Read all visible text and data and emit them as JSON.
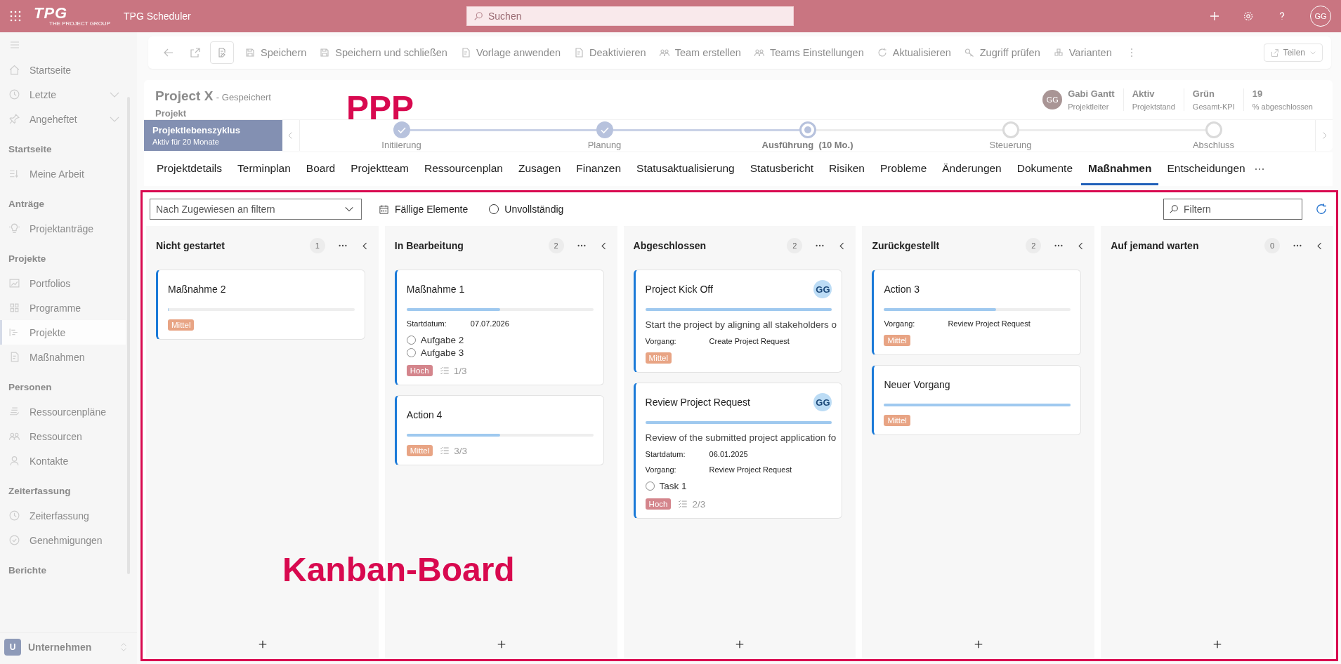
{
  "app_bar": {
    "logo": "TPG",
    "logo_subtitle": "THE PROJECT GROUP",
    "title": "TPG Scheduler",
    "search_placeholder": "Suchen",
    "avatar": "GG"
  },
  "sidebar": {
    "items": [
      {
        "kind": "item",
        "label": "Startseite",
        "selected": false
      },
      {
        "kind": "item",
        "label": "Letzte",
        "selected": false,
        "expandable": true
      },
      {
        "kind": "item",
        "label": "Angeheftet",
        "selected": false,
        "expandable": true
      },
      {
        "kind": "section",
        "label": "Startseite"
      },
      {
        "kind": "item",
        "label": "Meine Arbeit",
        "selected": false
      },
      {
        "kind": "section",
        "label": "Anträge"
      },
      {
        "kind": "item",
        "label": "Projektanträge",
        "selected": false
      },
      {
        "kind": "section",
        "label": "Projekte"
      },
      {
        "kind": "item",
        "label": "Portfolios",
        "selected": false
      },
      {
        "kind": "item",
        "label": "Programme",
        "selected": false
      },
      {
        "kind": "item",
        "label": "Projekte",
        "selected": true
      },
      {
        "kind": "item",
        "label": "Maßnahmen",
        "selected": false
      },
      {
        "kind": "section",
        "label": "Personen"
      },
      {
        "kind": "item",
        "label": "Ressourcenpläne",
        "selected": false
      },
      {
        "kind": "item",
        "label": "Ressourcen",
        "selected": false
      },
      {
        "kind": "item",
        "label": "Kontakte",
        "selected": false
      },
      {
        "kind": "section",
        "label": "Zeiterfassung"
      },
      {
        "kind": "item",
        "label": "Zeiterfassung",
        "selected": false
      },
      {
        "kind": "item",
        "label": "Genehmigungen",
        "selected": false
      },
      {
        "kind": "section",
        "label": "Berichte"
      }
    ],
    "area": {
      "initial": "U",
      "label": "Unternehmen"
    }
  },
  "toolbar": {
    "buttons": [
      {
        "label": "Speichern"
      },
      {
        "label": "Speichern und schließen"
      },
      {
        "label": "Vorlage anwenden"
      },
      {
        "label": "Deaktivieren"
      },
      {
        "label": "Team erstellen"
      },
      {
        "label": "Teams Einstellungen"
      },
      {
        "label": "Aktualisieren"
      },
      {
        "label": "Zugriff prüfen"
      },
      {
        "label": "Varianten"
      }
    ],
    "share": "Teilen"
  },
  "header": {
    "title": "Project X",
    "save_state": "- Gespeichert",
    "entity": "Projekt",
    "owner": {
      "initials": "GG",
      "name": "Gabi Gantt",
      "role": "Projektleiter"
    },
    "stats": [
      {
        "value": "Aktiv",
        "label": "Projektstand"
      },
      {
        "value": "Grün",
        "label": "Gesamt-KPI"
      },
      {
        "value": "19",
        "label": "% abgeschlossen"
      }
    ]
  },
  "lifecycle": {
    "title": "Projektlebenszyklus",
    "subtitle": "Aktiv für 20 Monate",
    "stages": [
      {
        "label": "Initiierung",
        "done": true,
        "current": false
      },
      {
        "label": "Planung",
        "done": true,
        "current": false
      },
      {
        "label": "Ausführung",
        "duration": "(10 Mo.)",
        "done": false,
        "current": true
      },
      {
        "label": "Steuerung",
        "done": false,
        "current": false
      },
      {
        "label": "Abschluss",
        "done": false,
        "current": false
      }
    ]
  },
  "tabs": [
    {
      "label": "Projektdetails",
      "selected": false
    },
    {
      "label": "Terminplan",
      "selected": false
    },
    {
      "label": "Board",
      "selected": false
    },
    {
      "label": "Projektteam",
      "selected": false
    },
    {
      "label": "Ressourcenplan",
      "selected": false
    },
    {
      "label": "Zusagen",
      "selected": false
    },
    {
      "label": "Finanzen",
      "selected": false
    },
    {
      "label": "Statusaktualisierung",
      "selected": false
    },
    {
      "label": "Statusbericht",
      "selected": false
    },
    {
      "label": "Risiken",
      "selected": false
    },
    {
      "label": "Probleme",
      "selected": false
    },
    {
      "label": "Änderungen",
      "selected": false
    },
    {
      "label": "Dokumente",
      "selected": false
    },
    {
      "label": "Maßnahmen",
      "selected": true
    },
    {
      "label": "Entscheidungen",
      "selected": false
    }
  ],
  "board": {
    "assignee_filter_placeholder": "Nach Zugewiesen an filtern",
    "due_items": "Fällige Elemente",
    "incomplete": {
      "label": "Unvollständig",
      "checked": false
    },
    "filter_placeholder": "Filtern",
    "columns": [
      {
        "title": "Nicht gestartet",
        "count": "1",
        "cards": [
          {
            "title": "Maßnahme 2",
            "level": 0,
            "priority": {
              "label": "Mittel",
              "color": "#e8a484"
            }
          }
        ]
      },
      {
        "title": "In Bearbeitung",
        "count": "2",
        "cards": [
          {
            "title": "Maßnahme 1",
            "level": 0.5,
            "fields": [
              {
                "label": "Startdatum:",
                "value": "07.07.2026"
              }
            ],
            "checklist": [
              {
                "label": "Aufgabe 2",
                "checked": false
              },
              {
                "label": "Aufgabe 3",
                "checked": false
              }
            ],
            "priority": {
              "label": "Hoch",
              "color": "#d4858c"
            },
            "progress": "1/3"
          },
          {
            "title": "Action 4",
            "level": 0.5,
            "priority": {
              "label": "Mittel",
              "color": "#e8a484"
            },
            "progress": "3/3"
          }
        ]
      },
      {
        "title": "Abgeschlossen",
        "count": "2",
        "cards": [
          {
            "title": "Project Kick Off",
            "assignee": "GG",
            "level": 1,
            "description": "Start the project by aligning all stakeholders o",
            "fields": [
              {
                "label": "Vorgang:",
                "value": "Create Project Request"
              }
            ],
            "priority": {
              "label": "Mittel",
              "color": "#e8a484"
            }
          },
          {
            "title": "Review Project Request",
            "assignee": "GG",
            "level": 1,
            "description": "Review of the submitted project application fo",
            "fields": [
              {
                "label": "Startdatum:",
                "value": "06.01.2025"
              },
              {
                "label": "Vorgang:",
                "value": "Review Project Request"
              }
            ],
            "checklist": [
              {
                "label": "Task 1",
                "checked": false
              }
            ],
            "priority": {
              "label": "Hoch",
              "color": "#d4858c"
            },
            "progress": "2/3"
          }
        ]
      },
      {
        "title": "Zurückgestellt",
        "count": "2",
        "cards": [
          {
            "title": "Action 3",
            "level": 0.6,
            "fields": [
              {
                "label": "Vorgang:",
                "value": "Review Project Request"
              }
            ],
            "priority": {
              "label": "Mittel",
              "color": "#e8a484"
            }
          },
          {
            "title": "Neuer Vorgang",
            "level": 1,
            "priority": {
              "label": "Mittel",
              "color": "#e8a484"
            }
          }
        ]
      },
      {
        "title": "Auf jemand warten",
        "count": "0"
      }
    ]
  },
  "annotations": {
    "header_label": "PPP",
    "board_label": "Kanban-Board"
  }
}
